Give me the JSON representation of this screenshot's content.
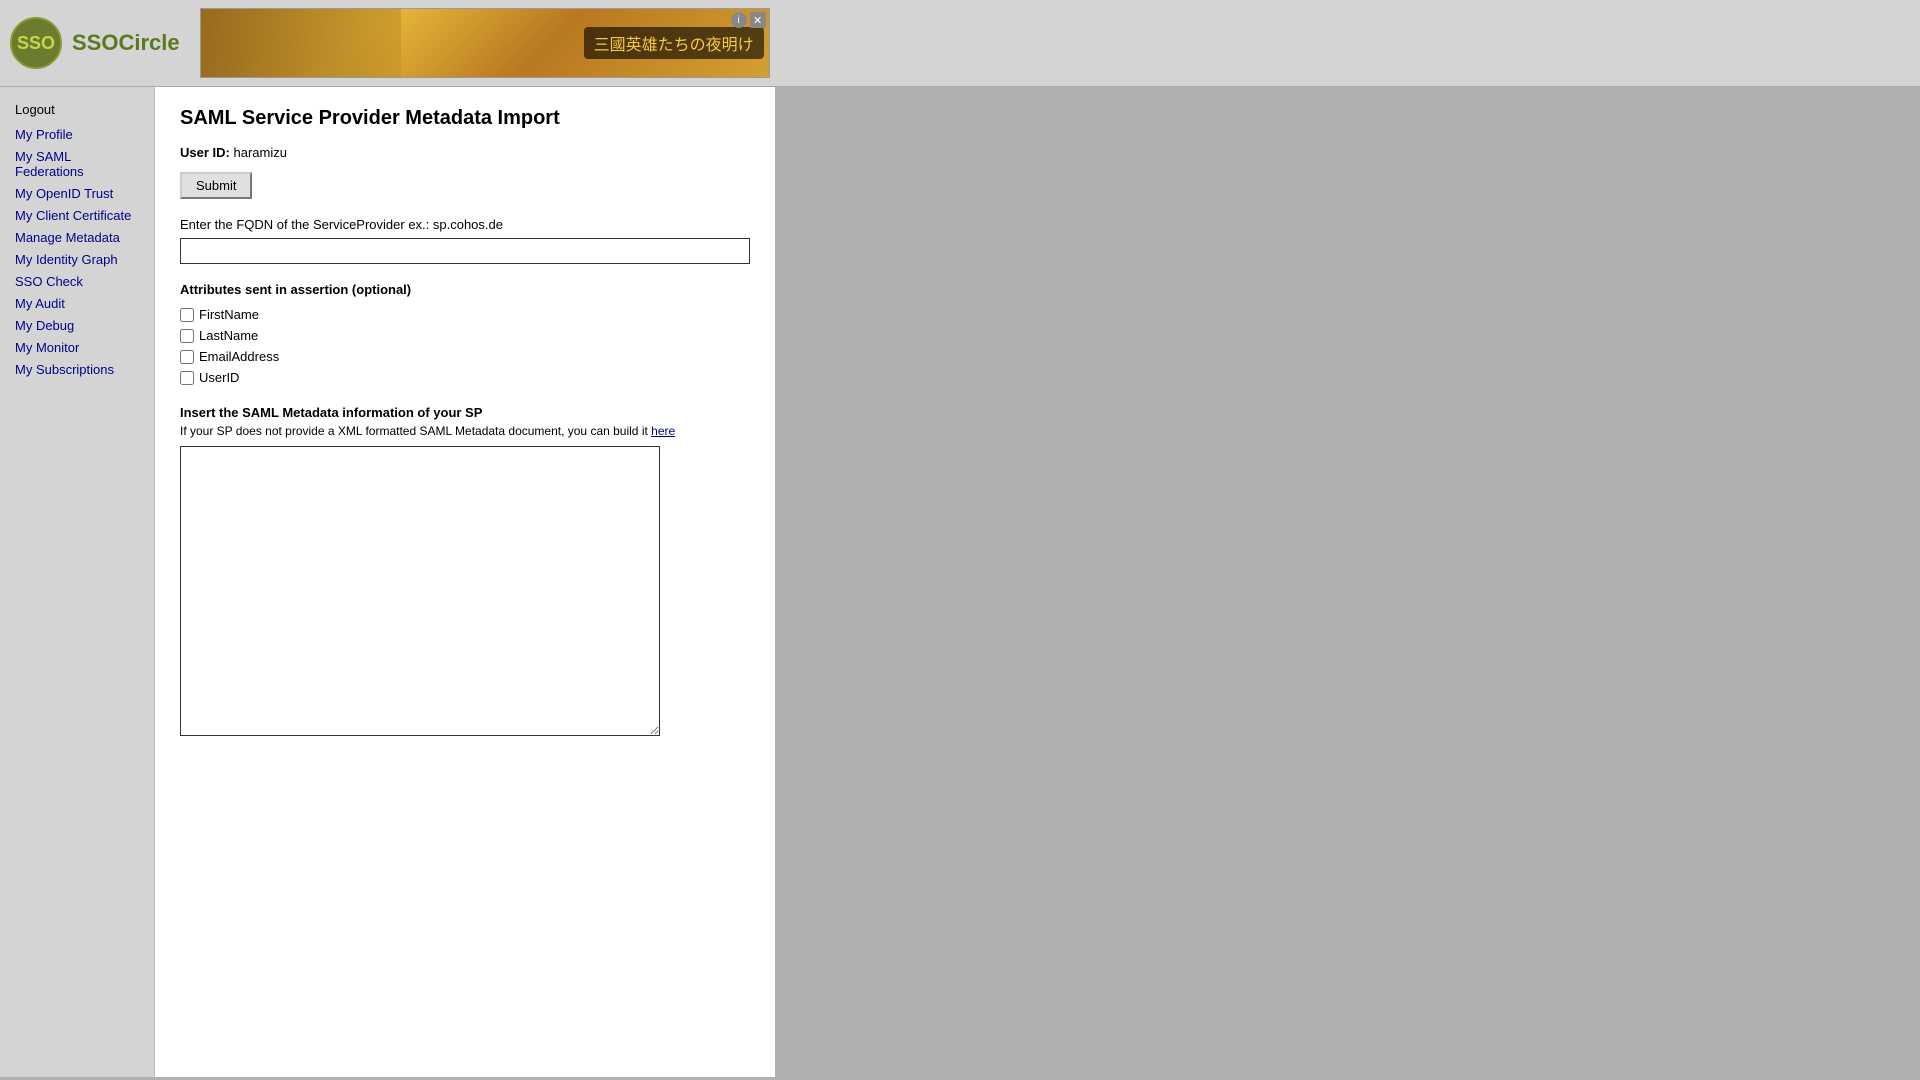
{
  "header": {
    "logo_text": "SSO",
    "logo_brand": "SSOCircle",
    "ad_text": "三國英雄たちの夜明け"
  },
  "sidebar": {
    "logout_label": "Logout",
    "items": [
      {
        "label": "My Profile",
        "name": "my-profile"
      },
      {
        "label": "My SAML Federations",
        "name": "my-saml-federations"
      },
      {
        "label": "My OpenID Trust",
        "name": "my-openid-trust"
      },
      {
        "label": "My Client Certificate",
        "name": "my-client-certificate"
      },
      {
        "label": "Manage Metadata",
        "name": "manage-metadata"
      },
      {
        "label": "My Identity Graph",
        "name": "my-identity-graph"
      },
      {
        "label": "SSO Check",
        "name": "sso-check"
      },
      {
        "label": "My Audit",
        "name": "my-audit"
      },
      {
        "label": "My Debug",
        "name": "my-debug"
      },
      {
        "label": "My Monitor",
        "name": "my-monitor"
      },
      {
        "label": "My Subscriptions",
        "name": "my-subscriptions"
      }
    ]
  },
  "main": {
    "title": "SAML Service Provider Metadata Import",
    "user_id_label": "User ID:",
    "user_id_value": "haramizu",
    "submit_label": "Submit",
    "fqdn_label": "Enter the FQDN of the ServiceProvider ex.: sp.cohos.de",
    "fqdn_placeholder": "",
    "attributes_label": "Attributes sent in assertion (optional)",
    "checkboxes": [
      {
        "label": "FirstName",
        "name": "firstname-checkbox"
      },
      {
        "label": "LastName",
        "name": "lastname-checkbox"
      },
      {
        "label": "EmailAddress",
        "name": "emailaddress-checkbox"
      },
      {
        "label": "UserID",
        "name": "userid-checkbox"
      }
    ],
    "insert_label": "Insert the SAML Metadata information of your SP",
    "insert_sublabel": "If your SP does not provide a XML formatted SAML Metadata document, you can build it",
    "insert_link_text": "here",
    "metadata_placeholder": ""
  }
}
